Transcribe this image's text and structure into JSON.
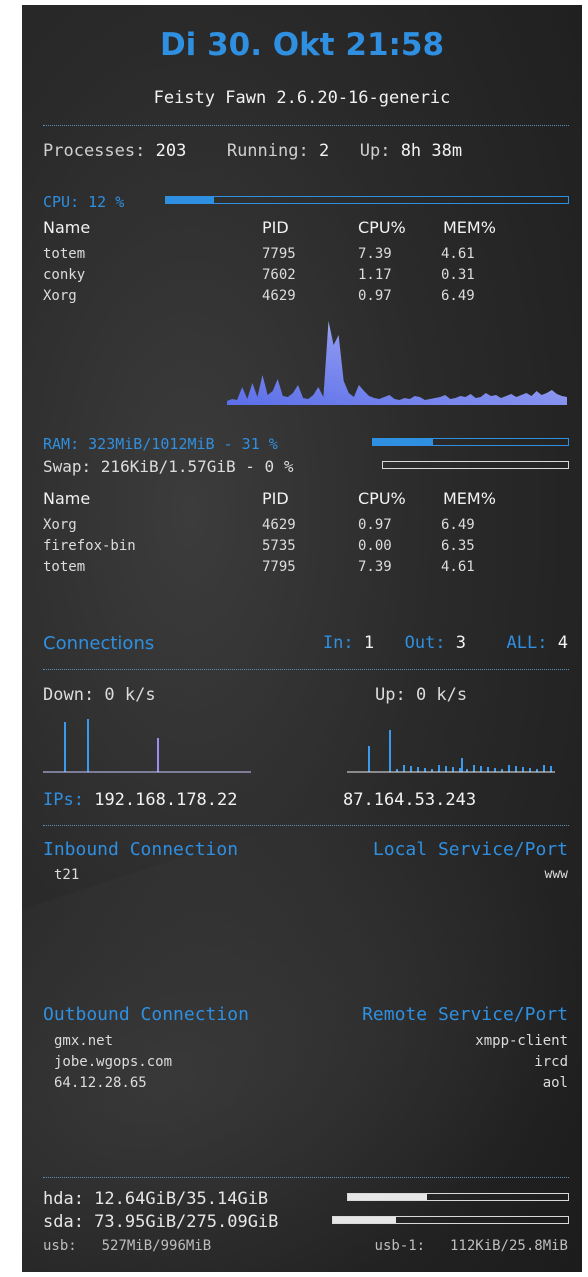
{
  "header": {
    "datetime": "Di 30. Okt 21:58",
    "system": "Feisty Fawn 2.6.20-16-generic"
  },
  "stats": {
    "processes_label": "Processes:",
    "processes_value": "203",
    "running_label": "Running:",
    "running_value": "2",
    "up_label": "Up:",
    "up_value": "8h 38m"
  },
  "cpu": {
    "label": "CPU: 12 %",
    "usage_fraction": 0.12,
    "columns": [
      "Name",
      "PID",
      "CPU%",
      "MEM%"
    ],
    "rows": [
      {
        "name": "totem",
        "pid": "7795",
        "cpu": "7.39",
        "mem": "4.61"
      },
      {
        "name": "conky",
        "pid": "7602",
        "cpu": "1.17",
        "mem": "0.31"
      },
      {
        "name": "Xorg",
        "pid": "4629",
        "cpu": "0.97",
        "mem": "6.49"
      }
    ]
  },
  "ram": {
    "label": "RAM: 323MiB/1012MiB - 31 %",
    "usage_fraction": 0.31,
    "swap_label": "Swap: 216KiB/1.57GiB - 0  %",
    "swap_fraction": 0.0,
    "columns": [
      "Name",
      "PID",
      "CPU%",
      "MEM%"
    ],
    "rows": [
      {
        "name": "Xorg",
        "pid": "4629",
        "cpu": "0.97",
        "mem": "6.49"
      },
      {
        "name": "firefox-bin",
        "pid": "5735",
        "cpu": "0.00",
        "mem": "6.35"
      },
      {
        "name": "totem",
        "pid": "7795",
        "cpu": "7.39",
        "mem": "4.61"
      }
    ]
  },
  "connections": {
    "title": "Connections",
    "in_label": "In:",
    "in_value": "1",
    "out_label": "Out:",
    "out_value": "3",
    "all_label": "ALL:",
    "all_value": "4",
    "down_label": "Down: 0     k/s",
    "up_label": "Up: 0     k/s",
    "ips_label": "IPs:",
    "ip_local": "192.168.178.22",
    "ip_public": "87.164.53.243"
  },
  "inbound": {
    "title": "Inbound Connection",
    "service_title": "Local Service/Port",
    "rows": [
      {
        "host": "t21",
        "service": "www"
      }
    ]
  },
  "outbound": {
    "title": "Outbound Connection",
    "service_title": "Remote Service/Port",
    "rows": [
      {
        "host": "gmx.net",
        "service": "xmpp-client"
      },
      {
        "host": "jobe.wgops.com",
        "service": "ircd"
      },
      {
        "host": "64.12.28.65",
        "service": "aol"
      }
    ]
  },
  "disks": [
    {
      "label": "hda:  12.64GiB/35.14GiB",
      "fraction": 0.36
    },
    {
      "label": "sda: 73.95GiB/275.09GiB",
      "fraction": 0.27
    }
  ],
  "usb": {
    "usb_label": "usb:",
    "usb_value": "527MiB/996MiB",
    "usb1_label": "usb-1:",
    "usb1_value": "112KiB/25.8MiB"
  },
  "colors": {
    "accent": "#2f8fe0",
    "graph_top": "#ffffff",
    "graph_bottom": "#5a78e8"
  }
}
